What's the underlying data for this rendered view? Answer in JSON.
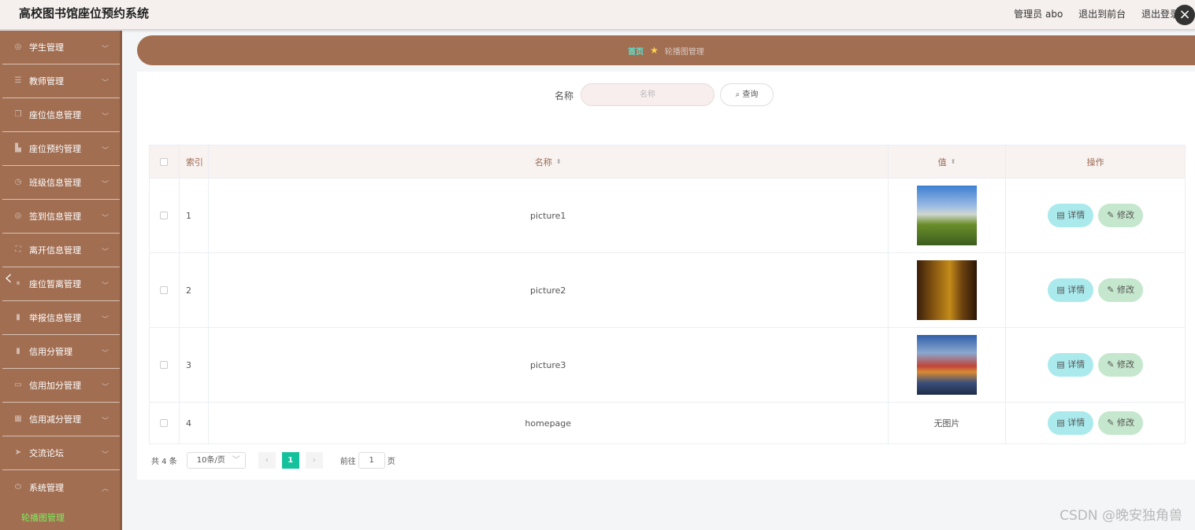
{
  "header": {
    "app_title": "高校图书馆座位预约系统",
    "role_user": "管理员 abo",
    "exit_front": "退出到前台",
    "logout": "退出登录"
  },
  "sidebar": {
    "items": [
      {
        "label": "学生管理",
        "icon": "globe-icon"
      },
      {
        "label": "教师管理",
        "icon": "list-icon"
      },
      {
        "label": "座位信息管理",
        "icon": "copy-icon"
      },
      {
        "label": "座位预约管理",
        "icon": "bank-icon"
      },
      {
        "label": "班级信息管理",
        "icon": "clock-icon"
      },
      {
        "label": "签到信息管理",
        "icon": "globe-icon"
      },
      {
        "label": "离开信息管理",
        "icon": "fullscreen-icon"
      },
      {
        "label": "座位暂离管理",
        "icon": "pause-icon"
      },
      {
        "label": "举报信息管理",
        "icon": "bar-chart-icon"
      },
      {
        "label": "信用分管理",
        "icon": "column-chart-icon"
      },
      {
        "label": "信用加分管理",
        "icon": "message-icon"
      },
      {
        "label": "信用减分管理",
        "icon": "grid-icon"
      },
      {
        "label": "交流论坛",
        "icon": "send-icon"
      },
      {
        "label": "系统管理",
        "icon": "power-icon"
      }
    ],
    "submenu_active": "轮播图管理"
  },
  "breadcrumb": {
    "home": "首页",
    "current": "轮播图管理"
  },
  "search": {
    "label": "名称",
    "placeholder": "名称",
    "button": "查询"
  },
  "table": {
    "headers": {
      "index": "索引",
      "name": "名称",
      "value": "值",
      "ops": "操作"
    },
    "rows": [
      {
        "index": "1",
        "name": "picture1",
        "value": "image",
        "thumb": "picture1"
      },
      {
        "index": "2",
        "name": "picture2",
        "value": "image",
        "thumb": "picture2"
      },
      {
        "index": "3",
        "name": "picture3",
        "value": "image",
        "thumb": "picture3"
      },
      {
        "index": "4",
        "name": "homepage",
        "value": "无图片",
        "thumb": ""
      }
    ],
    "detail_label": "详情",
    "edit_label": "修改"
  },
  "pagination": {
    "total": "共 4 条",
    "page_size": "10条/页",
    "current_page": "1",
    "goto_label": "前往",
    "goto_value": "1",
    "page_suffix": "页"
  },
  "watermark": "CSDN @晚安独角兽",
  "colors": {
    "sidebar": "#a16e52",
    "accent_teal": "#13c19c",
    "detail_btn": "#aaeaed",
    "edit_btn": "#c5e7cd"
  }
}
